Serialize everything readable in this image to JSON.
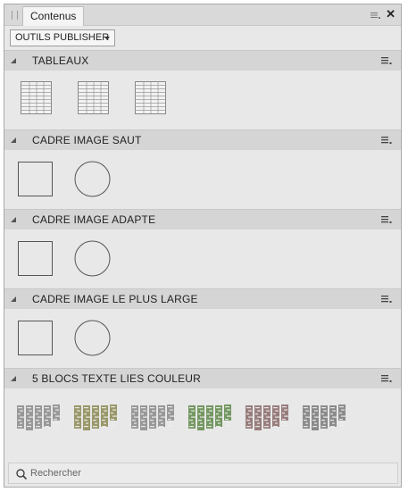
{
  "panel": {
    "tab_label": "Contenus",
    "dropdown_value": "OUTILS PUBLISHER"
  },
  "sections": [
    {
      "title": "TABLEAUX",
      "items": [
        "table",
        "table",
        "table"
      ]
    },
    {
      "title": "CADRE IMAGE SAUT",
      "items": [
        "square-frame",
        "circle-frame"
      ]
    },
    {
      "title": "CADRE IMAGE ADAPTE",
      "items": [
        "square-frame",
        "circle-frame"
      ]
    },
    {
      "title": "CADRE IMAGE LE PLUS LARGE",
      "items": [
        "square-frame",
        "circle-frame"
      ]
    },
    {
      "title": "5 BLOCS TEXTE LIES COULEUR",
      "items": [
        "text-blocks-gray",
        "text-blocks-olive",
        "text-blocks-gray",
        "text-blocks-green",
        "text-blocks-mauve",
        "text-blocks-gray"
      ]
    }
  ],
  "text_block_colors": [
    "#8a8a8a",
    "#8c8a55",
    "#8a8a8a",
    "#5f8a4a",
    "#8a6a6a",
    "#7a7a7a"
  ],
  "search": {
    "placeholder": "Rechercher"
  }
}
